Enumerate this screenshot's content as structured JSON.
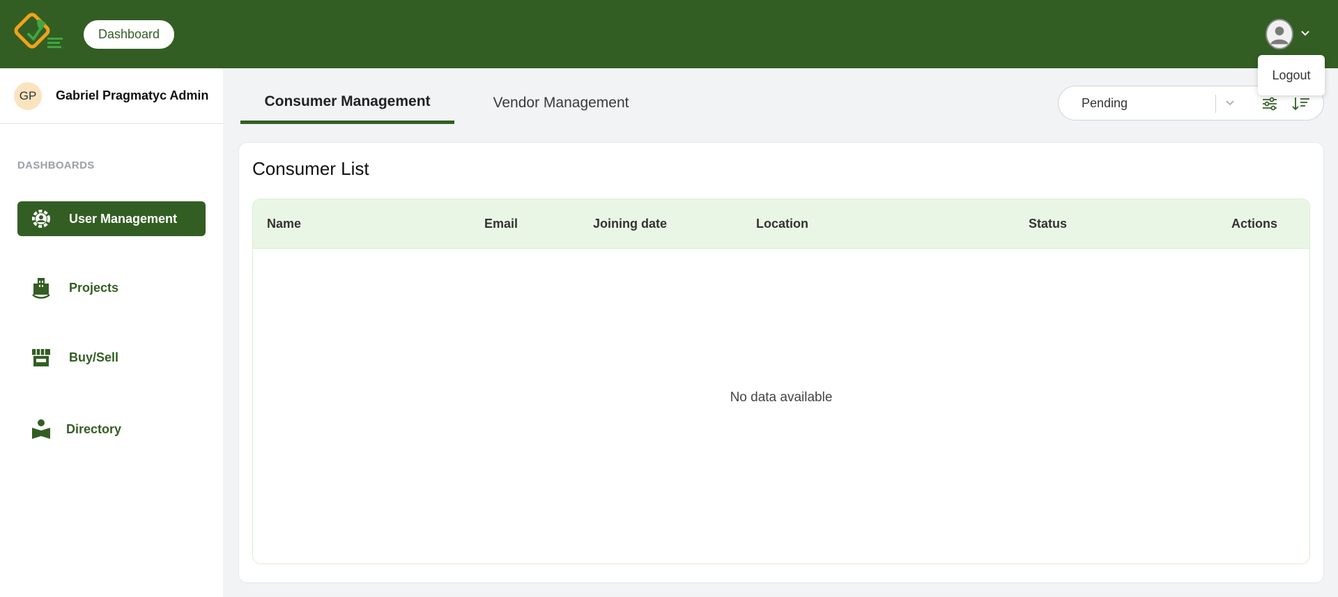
{
  "header": {
    "dashboard_label": "Dashboard",
    "brand_color": "#335e23",
    "logo_icon": "leaf-check-logo",
    "user_menu": {
      "icon": "user-avatar-icon",
      "chevron": "chevron-down-icon",
      "logout_label": "Logout"
    }
  },
  "sidebar": {
    "profile": {
      "initials": "GP",
      "name": "Gabriel Pragmatyc Admin"
    },
    "section_label": "DASHBOARDS",
    "items": [
      {
        "label": "User Management",
        "icon": "gear-user-icon",
        "active": true
      },
      {
        "label": "Projects",
        "icon": "projects-building-icon",
        "active": false
      },
      {
        "label": "Buy/Sell",
        "icon": "store-icon",
        "active": false
      },
      {
        "label": "Directory",
        "icon": "reader-book-icon",
        "active": false
      }
    ]
  },
  "tabs": [
    {
      "label": "Consumer Management",
      "active": true
    },
    {
      "label": "Vendor Management",
      "active": false
    }
  ],
  "filter": {
    "selected_value": "Pending",
    "icons": [
      "chevron-down-icon",
      "filter-sliders-icon",
      "sort-icon"
    ]
  },
  "main": {
    "card_title": "Consumer List",
    "table": {
      "columns": [
        "Name",
        "Email",
        "Joining date",
        "Location",
        "Status",
        "Actions"
      ],
      "rows": [],
      "empty_message": "No data available"
    }
  }
}
